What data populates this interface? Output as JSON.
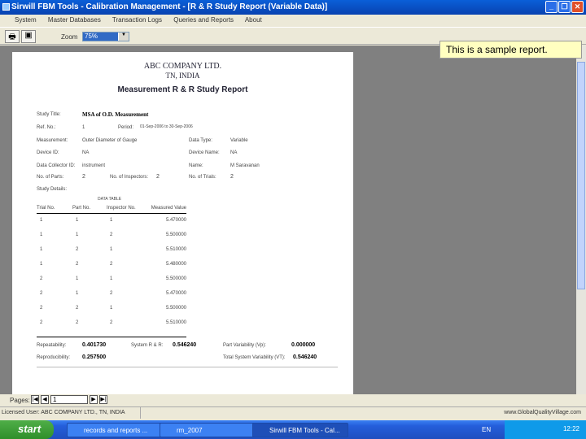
{
  "window": {
    "title": "Sirwill FBM Tools - Calibration Management - [R & R Study Report (Variable Data)]",
    "minimize": "_",
    "restore": "❐",
    "close": "✕"
  },
  "menu": [
    "System",
    "Master Databases",
    "Transaction Logs",
    "Queries and Reports",
    "About"
  ],
  "toolbar": {
    "print_icon": "🖶",
    "export_icon": "▣",
    "zoom_label": "Zoom",
    "zoom_value": "75%",
    "zoom_arrow": "▼"
  },
  "callout": "This is a sample report.",
  "report": {
    "company": "ABC COMPANY LTD.",
    "location": "TN, INDIA",
    "title": "Measurement R & R Study Report",
    "fields": {
      "study_title_label": "Study Title:",
      "study_title": "MSA of O.D. Measurement",
      "ref_no_label": "Ref. No.:",
      "ref_no": "1",
      "period_label": "Period:",
      "period": "01-Sep-2006 to 30-Sep-2006",
      "measurement_label": "Measurement:",
      "measurement": "Outer Diameter of Gauge",
      "data_type_label": "Data Type:",
      "data_type": "Variable",
      "device_id_label": "Device ID:",
      "device_id": "NA",
      "device_name_label": "Device Name:",
      "device_name": "NA",
      "collector_label": "Data Collector ID:",
      "collector": "instrument",
      "name_label": "Name:",
      "name": "M Saravanan",
      "parts_label": "No. of Parts:",
      "parts": "2",
      "inspectors_label": "No. of Inspectors:",
      "inspectors": "2",
      "trials_label": "No. of Trials:",
      "trials": "2",
      "study_details_label": "Study Details:"
    },
    "table_title": "DATA TABLE",
    "columns": [
      "Trial No.",
      "Part No.",
      "Inspector No.",
      "Measured Value"
    ],
    "rows": [
      [
        "1",
        "1",
        "1",
        "5.470000"
      ],
      [
        "1",
        "1",
        "2",
        "5.500000"
      ],
      [
        "1",
        "2",
        "1",
        "5.510000"
      ],
      [
        "1",
        "2",
        "2",
        "5.480000"
      ],
      [
        "2",
        "1",
        "1",
        "5.500000"
      ],
      [
        "2",
        "1",
        "2",
        "5.470000"
      ],
      [
        "2",
        "2",
        "1",
        "5.500000"
      ],
      [
        "2",
        "2",
        "2",
        "5.510000"
      ]
    ],
    "summary": {
      "repeatability_label": "Repeatability:",
      "repeatability": "0.401730",
      "reproducibility_label": "Reproducibility:",
      "reproducibility": "0.257500",
      "system_rr_label": "System R & R:",
      "system_rr": "0.546240",
      "part_var_label": "Part Variability (Vp):",
      "part_var": "0.000000",
      "total_var_label": "Total System Variability (VT):",
      "total_var": "0.546240"
    }
  },
  "pager": {
    "label": "Pages:",
    "first": "|◀",
    "prev": "◀",
    "value": "1",
    "next": "▶",
    "last": "▶|"
  },
  "status": {
    "license": "Licensed User: ABC COMPANY LTD., TN, INDIA",
    "website": "www.GlobalQualityVillage.com"
  },
  "taskbar": {
    "start": "start",
    "tasks": [
      "records and reports ...",
      "rm_2007",
      "Sirwill FBM Tools - Cal..."
    ],
    "lang": "EN",
    "clock": "12:22"
  }
}
